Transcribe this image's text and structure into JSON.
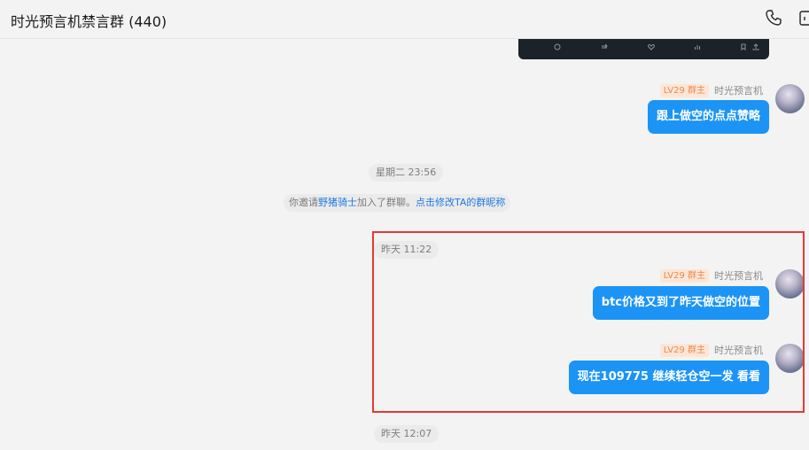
{
  "header": {
    "title": "时光预言机禁言群 (440)",
    "call_icon": "phone-icon",
    "more_icon": "panel-icon"
  },
  "messages": [
    {
      "badge": "LV29 群主",
      "sender": "时光预言机",
      "text": "跟上做空的点点赞略"
    },
    {
      "badge": "LV29 群主",
      "sender": "时光预言机",
      "text": "btc价格又到了昨天做空的位置"
    },
    {
      "badge": "LV29 群主",
      "sender": "时光预言机",
      "text": "现在109775 继续轻仓空一发 看看"
    }
  ],
  "timestamps": {
    "t1": "星期二 23:56",
    "t2": "昨天 11:22",
    "t3": "昨天 12:07"
  },
  "notice": {
    "prefix": "你邀请",
    "user": "野猪骑士",
    "middle": "加入了群聊。",
    "action": "点击修改TA的群昵称"
  },
  "colors": {
    "bubble": "#1c94f5",
    "badge_text": "#e8894e",
    "badge_bg": "#fde6d6",
    "link": "#1f7ae0",
    "highlight": "#e53935"
  }
}
